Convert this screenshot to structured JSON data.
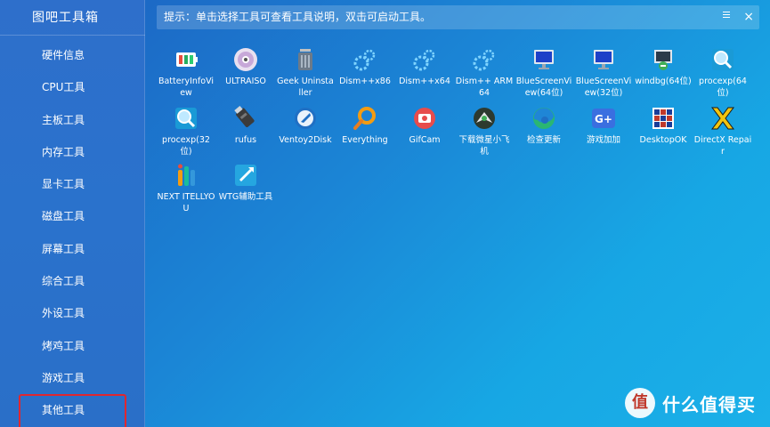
{
  "app": {
    "title": "图吧工具箱"
  },
  "hint": {
    "text": "提示：单击选择工具可查看工具说明，双击可启动工具。",
    "close": "×"
  },
  "sidebar": {
    "items": [
      {
        "label": "硬件信息"
      },
      {
        "label": "CPU工具"
      },
      {
        "label": "主板工具"
      },
      {
        "label": "内存工具"
      },
      {
        "label": "显卡工具"
      },
      {
        "label": "磁盘工具"
      },
      {
        "label": "屏幕工具"
      },
      {
        "label": "综合工具"
      },
      {
        "label": "外设工具"
      },
      {
        "label": "烤鸡工具"
      },
      {
        "label": "游戏工具"
      },
      {
        "label": "其他工具"
      }
    ],
    "selected_index": 11
  },
  "tools": [
    {
      "label": "BatteryInfoView",
      "icon": "battery-icon"
    },
    {
      "label": "ULTRAISO",
      "icon": "disc-icon"
    },
    {
      "label": "Geek Uninstaller",
      "icon": "trash-can-icon"
    },
    {
      "label": "Dism++x86",
      "icon": "gear-icon"
    },
    {
      "label": "Dism++x64",
      "icon": "gear-icon"
    },
    {
      "label": "Dism++ ARM64",
      "icon": "gear-icon"
    },
    {
      "label": "BlueScreenView(64位)",
      "icon": "monitor-icon"
    },
    {
      "label": "BlueScreenView(32位)",
      "icon": "monitor-icon"
    },
    {
      "label": "windbg(64位)",
      "icon": "debugger-icon"
    },
    {
      "label": "procexp(64位)",
      "icon": "magnifier-icon"
    },
    {
      "label": "procexp(32位)",
      "icon": "magnifier-icon"
    },
    {
      "label": "rufus",
      "icon": "usb-drive-icon"
    },
    {
      "label": "Ventoy2Disk",
      "icon": "ventoy-icon"
    },
    {
      "label": "Everything",
      "icon": "search-icon"
    },
    {
      "label": "GifCam",
      "icon": "camera-icon"
    },
    {
      "label": "下载微星小飞机",
      "icon": "afterburner-icon"
    },
    {
      "label": "检查更新",
      "icon": "edge-icon"
    },
    {
      "label": "游戏加加",
      "icon": "game-plus-icon"
    },
    {
      "label": "DesktopOK",
      "icon": "desktop-grid-icon"
    },
    {
      "label": "DirectX Repair",
      "icon": "directx-icon"
    },
    {
      "label": "NEXT ITELLYOU",
      "icon": "next-itellyou-icon"
    },
    {
      "label": "WTG辅助工具",
      "icon": "wtg-icon"
    }
  ],
  "watermark": {
    "text": "什么值得买",
    "logo": "值"
  },
  "colors": {
    "accent_red": "#e0272f",
    "bg_start": "#1c5fc0",
    "bg_end": "#1bb0e8"
  }
}
